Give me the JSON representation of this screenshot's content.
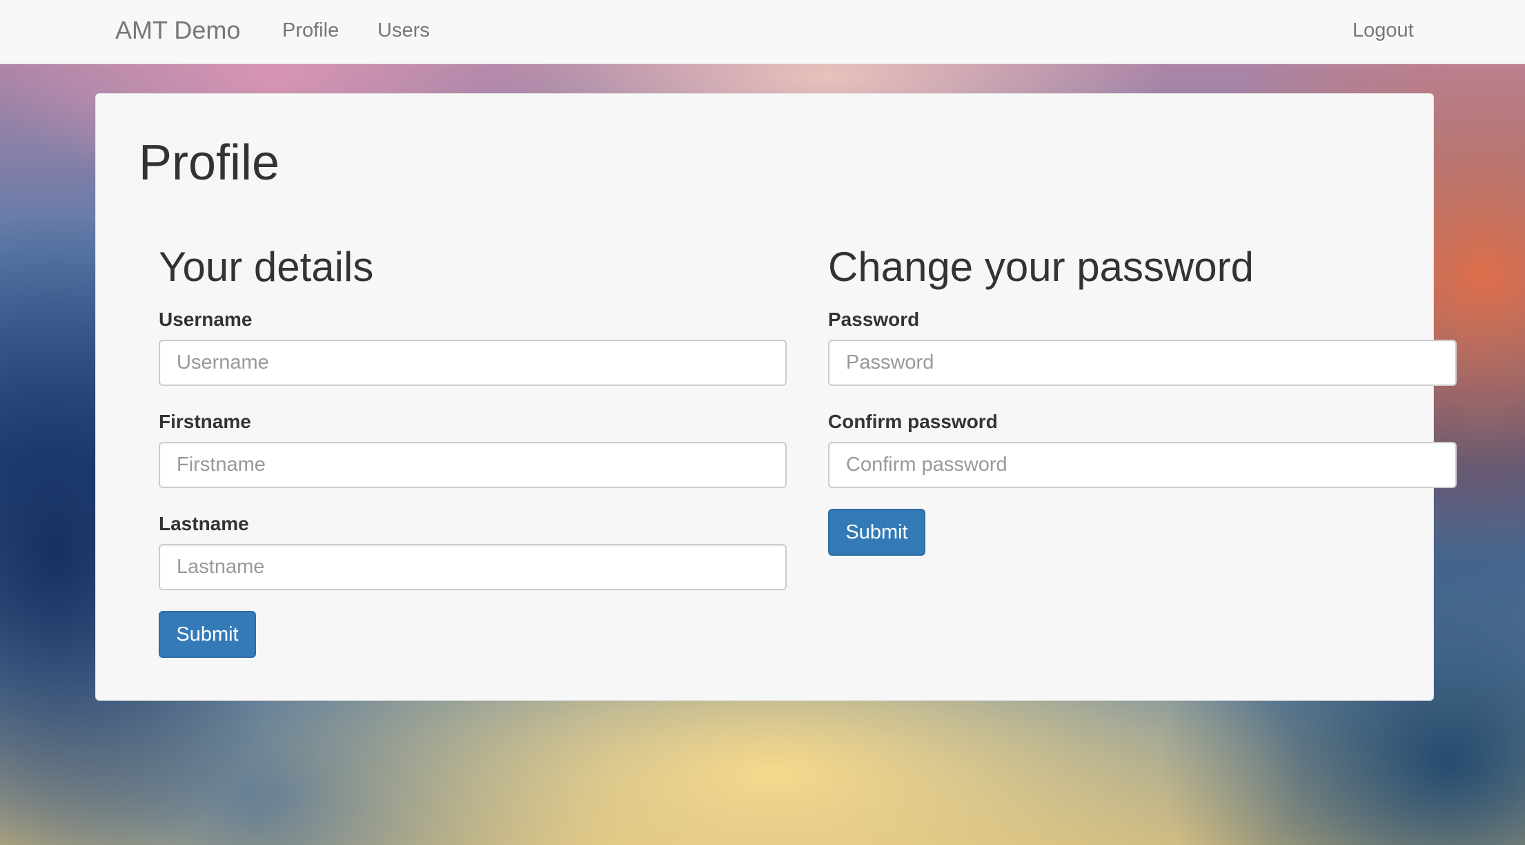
{
  "navbar": {
    "brand": "AMT Demo",
    "links": [
      "Profile",
      "Users"
    ],
    "logout": "Logout"
  },
  "page": {
    "title": "Profile"
  },
  "details_form": {
    "title": "Your details",
    "username_label": "Username",
    "username_placeholder": "Username",
    "username_value": "",
    "firstname_label": "Firstname",
    "firstname_placeholder": "Firstname",
    "firstname_value": "",
    "lastname_label": "Lastname",
    "lastname_placeholder": "Lastname",
    "lastname_value": "",
    "submit_label": "Submit"
  },
  "password_form": {
    "title": "Change your password",
    "password_label": "Password",
    "password_placeholder": "Password",
    "password_value": "",
    "confirm_label": "Confirm password",
    "confirm_placeholder": "Confirm password",
    "confirm_value": "",
    "submit_label": "Submit"
  },
  "colors": {
    "primary_button": "#337ab7",
    "navbar_bg": "#f8f8f8",
    "card_bg": "#f7f7f7"
  }
}
